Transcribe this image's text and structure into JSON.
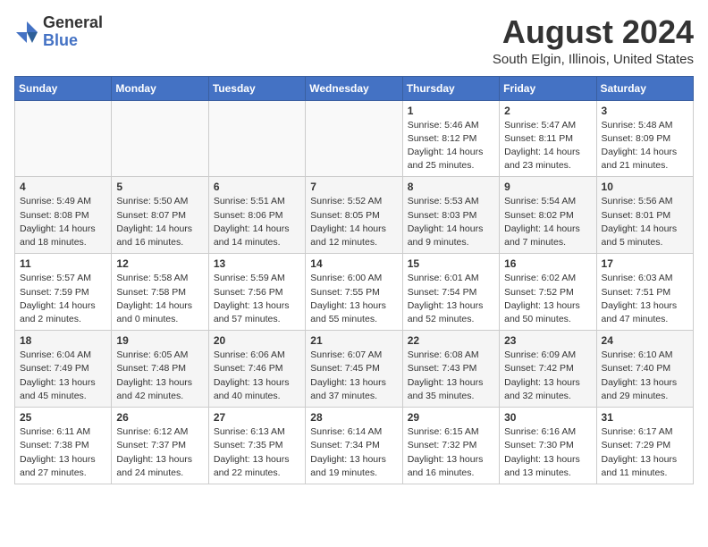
{
  "header": {
    "logo": {
      "general": "General",
      "blue": "Blue"
    },
    "title": "August 2024",
    "location": "South Elgin, Illinois, United States"
  },
  "days_of_week": [
    "Sunday",
    "Monday",
    "Tuesday",
    "Wednesday",
    "Thursday",
    "Friday",
    "Saturday"
  ],
  "weeks": [
    [
      {
        "day": "",
        "info": ""
      },
      {
        "day": "",
        "info": ""
      },
      {
        "day": "",
        "info": ""
      },
      {
        "day": "",
        "info": ""
      },
      {
        "day": "1",
        "info": "Sunrise: 5:46 AM\nSunset: 8:12 PM\nDaylight: 14 hours\nand 25 minutes."
      },
      {
        "day": "2",
        "info": "Sunrise: 5:47 AM\nSunset: 8:11 PM\nDaylight: 14 hours\nand 23 minutes."
      },
      {
        "day": "3",
        "info": "Sunrise: 5:48 AM\nSunset: 8:09 PM\nDaylight: 14 hours\nand 21 minutes."
      }
    ],
    [
      {
        "day": "4",
        "info": "Sunrise: 5:49 AM\nSunset: 8:08 PM\nDaylight: 14 hours\nand 18 minutes."
      },
      {
        "day": "5",
        "info": "Sunrise: 5:50 AM\nSunset: 8:07 PM\nDaylight: 14 hours\nand 16 minutes."
      },
      {
        "day": "6",
        "info": "Sunrise: 5:51 AM\nSunset: 8:06 PM\nDaylight: 14 hours\nand 14 minutes."
      },
      {
        "day": "7",
        "info": "Sunrise: 5:52 AM\nSunset: 8:05 PM\nDaylight: 14 hours\nand 12 minutes."
      },
      {
        "day": "8",
        "info": "Sunrise: 5:53 AM\nSunset: 8:03 PM\nDaylight: 14 hours\nand 9 minutes."
      },
      {
        "day": "9",
        "info": "Sunrise: 5:54 AM\nSunset: 8:02 PM\nDaylight: 14 hours\nand 7 minutes."
      },
      {
        "day": "10",
        "info": "Sunrise: 5:56 AM\nSunset: 8:01 PM\nDaylight: 14 hours\nand 5 minutes."
      }
    ],
    [
      {
        "day": "11",
        "info": "Sunrise: 5:57 AM\nSunset: 7:59 PM\nDaylight: 14 hours\nand 2 minutes."
      },
      {
        "day": "12",
        "info": "Sunrise: 5:58 AM\nSunset: 7:58 PM\nDaylight: 14 hours\nand 0 minutes."
      },
      {
        "day": "13",
        "info": "Sunrise: 5:59 AM\nSunset: 7:56 PM\nDaylight: 13 hours\nand 57 minutes."
      },
      {
        "day": "14",
        "info": "Sunrise: 6:00 AM\nSunset: 7:55 PM\nDaylight: 13 hours\nand 55 minutes."
      },
      {
        "day": "15",
        "info": "Sunrise: 6:01 AM\nSunset: 7:54 PM\nDaylight: 13 hours\nand 52 minutes."
      },
      {
        "day": "16",
        "info": "Sunrise: 6:02 AM\nSunset: 7:52 PM\nDaylight: 13 hours\nand 50 minutes."
      },
      {
        "day": "17",
        "info": "Sunrise: 6:03 AM\nSunset: 7:51 PM\nDaylight: 13 hours\nand 47 minutes."
      }
    ],
    [
      {
        "day": "18",
        "info": "Sunrise: 6:04 AM\nSunset: 7:49 PM\nDaylight: 13 hours\nand 45 minutes."
      },
      {
        "day": "19",
        "info": "Sunrise: 6:05 AM\nSunset: 7:48 PM\nDaylight: 13 hours\nand 42 minutes."
      },
      {
        "day": "20",
        "info": "Sunrise: 6:06 AM\nSunset: 7:46 PM\nDaylight: 13 hours\nand 40 minutes."
      },
      {
        "day": "21",
        "info": "Sunrise: 6:07 AM\nSunset: 7:45 PM\nDaylight: 13 hours\nand 37 minutes."
      },
      {
        "day": "22",
        "info": "Sunrise: 6:08 AM\nSunset: 7:43 PM\nDaylight: 13 hours\nand 35 minutes."
      },
      {
        "day": "23",
        "info": "Sunrise: 6:09 AM\nSunset: 7:42 PM\nDaylight: 13 hours\nand 32 minutes."
      },
      {
        "day": "24",
        "info": "Sunrise: 6:10 AM\nSunset: 7:40 PM\nDaylight: 13 hours\nand 29 minutes."
      }
    ],
    [
      {
        "day": "25",
        "info": "Sunrise: 6:11 AM\nSunset: 7:38 PM\nDaylight: 13 hours\nand 27 minutes."
      },
      {
        "day": "26",
        "info": "Sunrise: 6:12 AM\nSunset: 7:37 PM\nDaylight: 13 hours\nand 24 minutes."
      },
      {
        "day": "27",
        "info": "Sunrise: 6:13 AM\nSunset: 7:35 PM\nDaylight: 13 hours\nand 22 minutes."
      },
      {
        "day": "28",
        "info": "Sunrise: 6:14 AM\nSunset: 7:34 PM\nDaylight: 13 hours\nand 19 minutes."
      },
      {
        "day": "29",
        "info": "Sunrise: 6:15 AM\nSunset: 7:32 PM\nDaylight: 13 hours\nand 16 minutes."
      },
      {
        "day": "30",
        "info": "Sunrise: 6:16 AM\nSunset: 7:30 PM\nDaylight: 13 hours\nand 13 minutes."
      },
      {
        "day": "31",
        "info": "Sunrise: 6:17 AM\nSunset: 7:29 PM\nDaylight: 13 hours\nand 11 minutes."
      }
    ]
  ]
}
